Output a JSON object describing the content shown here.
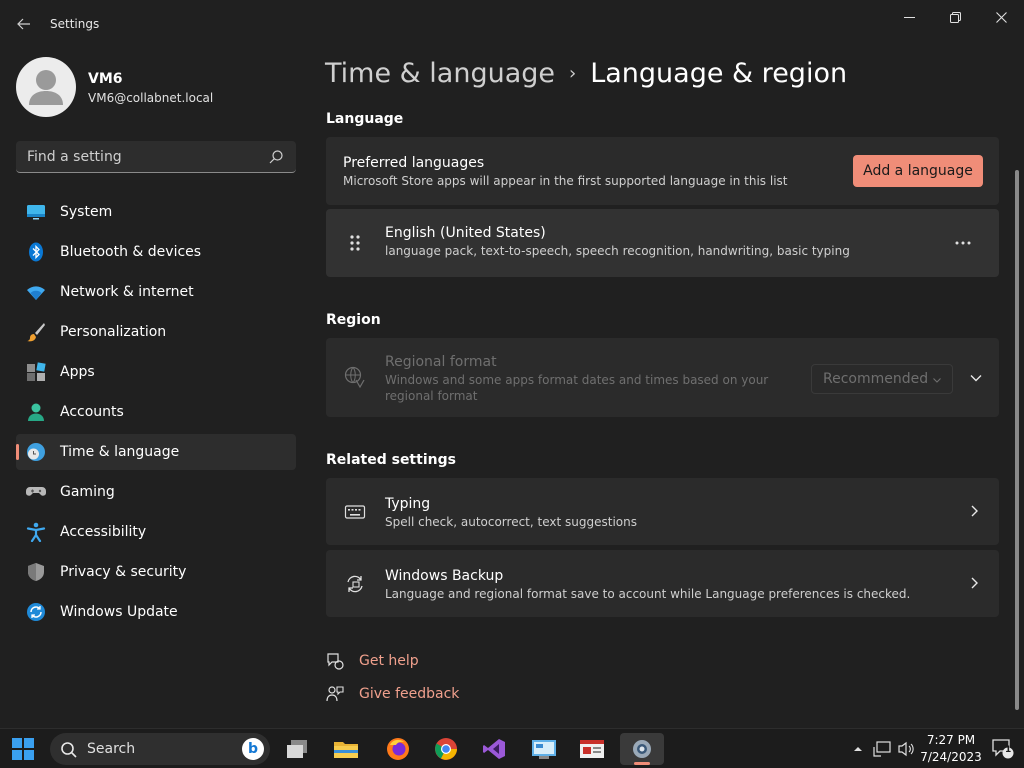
{
  "window": {
    "title": "Settings"
  },
  "profile": {
    "name": "VM6",
    "email": "VM6@collabnet.local"
  },
  "search": {
    "placeholder": "Find a setting",
    "value": ""
  },
  "nav": {
    "items": [
      {
        "label": "System",
        "icon": "system-icon"
      },
      {
        "label": "Bluetooth & devices",
        "icon": "bluetooth-icon"
      },
      {
        "label": "Network & internet",
        "icon": "wifi-icon"
      },
      {
        "label": "Personalization",
        "icon": "brush-icon"
      },
      {
        "label": "Apps",
        "icon": "apps-icon"
      },
      {
        "label": "Accounts",
        "icon": "person-icon"
      },
      {
        "label": "Time & language",
        "icon": "clock-globe-icon",
        "selected": true
      },
      {
        "label": "Gaming",
        "icon": "gamepad-icon"
      },
      {
        "label": "Accessibility",
        "icon": "accessibility-icon"
      },
      {
        "label": "Privacy & security",
        "icon": "shield-icon"
      },
      {
        "label": "Windows Update",
        "icon": "update-icon"
      }
    ]
  },
  "breadcrumb": {
    "parent": "Time & language",
    "separator": "›",
    "current": "Language & region"
  },
  "language": {
    "section_title": "Language",
    "preferred": {
      "title": "Preferred languages",
      "desc": "Microsoft Store apps will appear in the first supported language in this list",
      "button": "Add a language"
    },
    "installed": [
      {
        "name": "English (United States)",
        "features": "language pack, text-to-speech, speech recognition, handwriting, basic typing"
      }
    ]
  },
  "region": {
    "section_title": "Region",
    "format": {
      "title": "Regional format",
      "desc": "Windows and some apps format dates and times based on your regional format",
      "selected": "Recommended"
    }
  },
  "related": {
    "section_title": "Related settings",
    "items": [
      {
        "title": "Typing",
        "desc": "Spell check, autocorrect, text suggestions",
        "icon": "keyboard-icon"
      },
      {
        "title": "Windows Backup",
        "desc": "Language and regional format save to account while Language preferences is checked.",
        "icon": "backup-sync-icon"
      }
    ]
  },
  "links": {
    "help": "Get help",
    "feedback": "Give feedback"
  },
  "taskbar": {
    "search_label": "Search",
    "bing": "b",
    "apps": [
      "file-explorer-icon",
      "firefox-icon",
      "chrome-icon",
      "visual-studio-icon",
      "control-panel-icon",
      "news-icon",
      "settings-icon"
    ],
    "time": "7:27 PM",
    "date": "7/24/2023",
    "notification_count": "1"
  },
  "colors": {
    "accent": "#f08d78",
    "background": "#202020",
    "card": "#2b2b2b"
  }
}
